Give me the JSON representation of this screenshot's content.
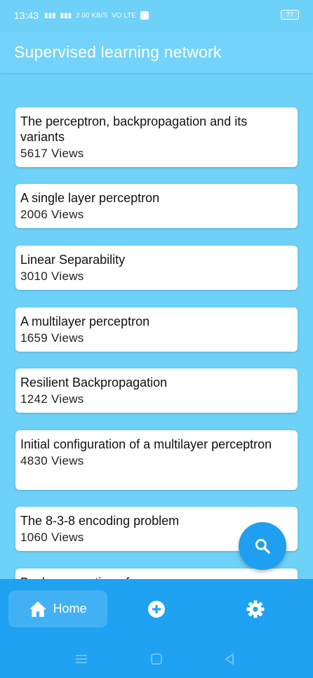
{
  "status_bar": {
    "time": "13:43",
    "network": "2.00 KB/S",
    "carrier": "VO LTE",
    "battery": "77"
  },
  "app_bar": {
    "title": "Supervised learning network"
  },
  "items": [
    {
      "title": "The perceptron, backpropagation and its variants",
      "views": "5617 Views"
    },
    {
      "title": "A single layer perceptron",
      "views": "2006 Views"
    },
    {
      "title": "Linear Separability",
      "views": "3010 Views"
    },
    {
      "title": "A multilayer perceptron",
      "views": "1659 Views"
    },
    {
      "title": "Resilient Backpropagation",
      "views": "1242 Views"
    },
    {
      "title": "Initial configuration of a multilayer perceptron",
      "views": "4830 Views"
    },
    {
      "title": "The 8-3-8 encoding problem",
      "views": "1060 Views"
    },
    {
      "title": "Backpropagation of",
      "views": ""
    }
  ],
  "fab": {
    "icon": "search-icon"
  },
  "bottom_nav": {
    "home_label": "Home",
    "home_icon": "home-icon",
    "add_icon": "add-circle-icon",
    "settings_icon": "gear-icon"
  },
  "colors": {
    "background": "#6ed1f8",
    "app_bar": "#73d3fa",
    "accent": "#1e9ff0",
    "bottom_nav": "#1ea2f1",
    "card": "#ffffff"
  }
}
